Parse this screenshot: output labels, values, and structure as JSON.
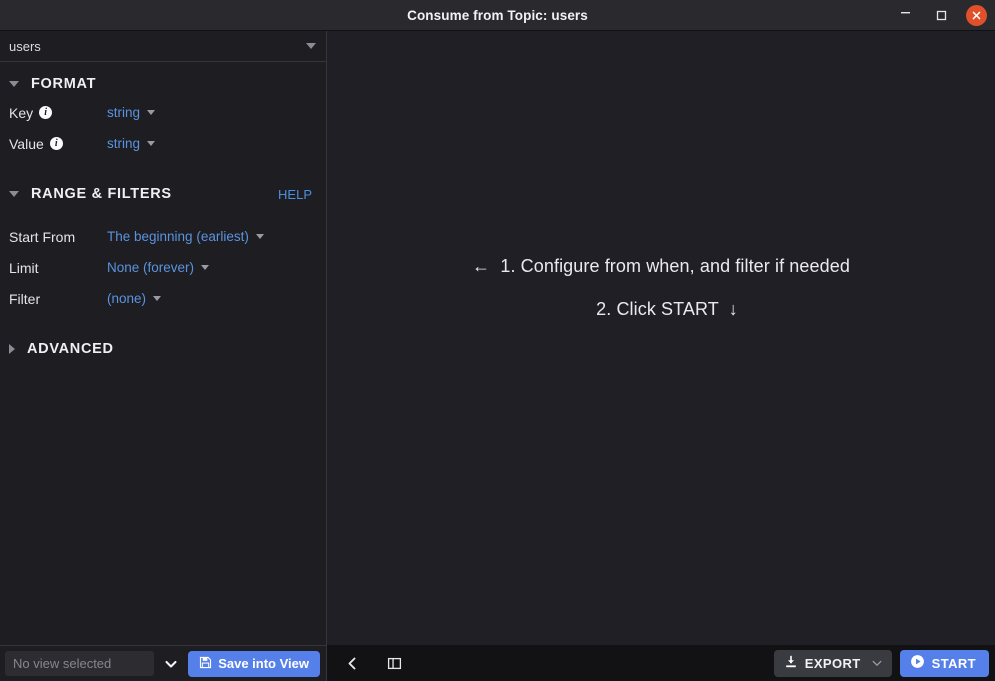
{
  "titlebar": {
    "title": "Consume from Topic: users",
    "minimize_label": "–",
    "maximize_label": "□",
    "close_label": "✕",
    "close_color": "#e0502a"
  },
  "sidebar": {
    "topic": {
      "name": "users"
    },
    "format_section": {
      "title": "FORMAT",
      "expanded": true,
      "fields": [
        {
          "label": "Key",
          "info": "i",
          "value": "string"
        },
        {
          "label": "Value",
          "info": "i",
          "value": "string"
        }
      ]
    },
    "range_section": {
      "title": "RANGE & FILTERS",
      "expanded": true,
      "help_label": "HELP",
      "fields": [
        {
          "label": "Start From",
          "value": "The beginning (earliest)"
        },
        {
          "label": "Limit",
          "value": "None (forever)"
        },
        {
          "label": "Filter",
          "value": "(none)"
        }
      ]
    },
    "advanced_section": {
      "title": "ADVANCED",
      "expanded": false
    },
    "footer": {
      "view_select_placeholder": "No view selected",
      "save_label": "Save into View"
    }
  },
  "main": {
    "instructions": [
      "←  1. Configure from when, and filter if needed",
      "2. Click START  ↓"
    ],
    "footer": {
      "export_label": "EXPORT",
      "start_label": "START"
    }
  },
  "colors": {
    "accent_blue": "#5680e9",
    "link_blue": "#5b93de",
    "close_orange": "#e0502a",
    "panel_bg": "#1f1f25",
    "sidebar_bg": "#1d1d22",
    "titlebar_bg": "#2a2a2e",
    "footer_bg": "#121215"
  }
}
